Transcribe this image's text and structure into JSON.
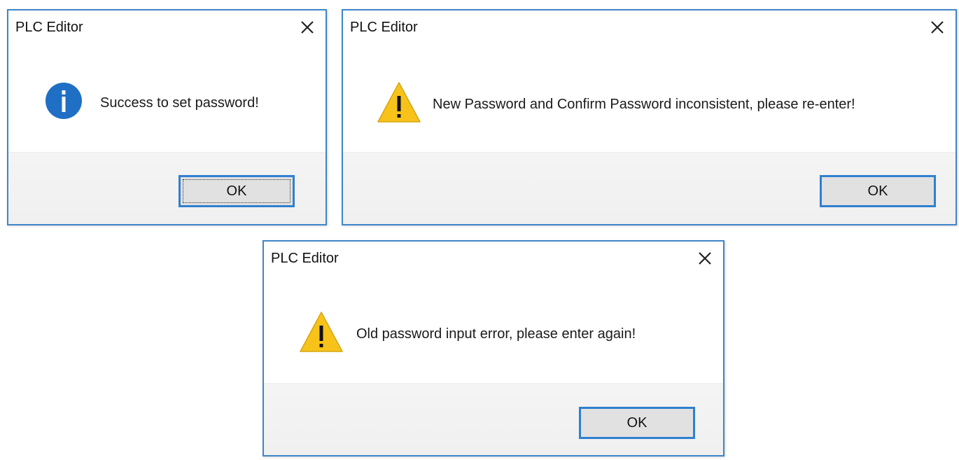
{
  "dialogs": [
    {
      "title": "PLC Editor",
      "icon": "info-icon",
      "message": "Success to set password!",
      "button_label": "OK",
      "button_focused": true
    },
    {
      "title": "PLC Editor",
      "icon": "warning-icon",
      "message": "New Password and Confirm Password inconsistent, please re-enter!",
      "button_label": "OK",
      "button_focused": false
    },
    {
      "title": "PLC Editor",
      "icon": "warning-icon",
      "message": "Old password input error, please enter again!",
      "button_label": "OK",
      "button_focused": false
    }
  ],
  "colors": {
    "accent": "#2f80d0",
    "info": "#1f6fc5",
    "warning": "#f7c31a",
    "footer": "#f0f0f0"
  }
}
